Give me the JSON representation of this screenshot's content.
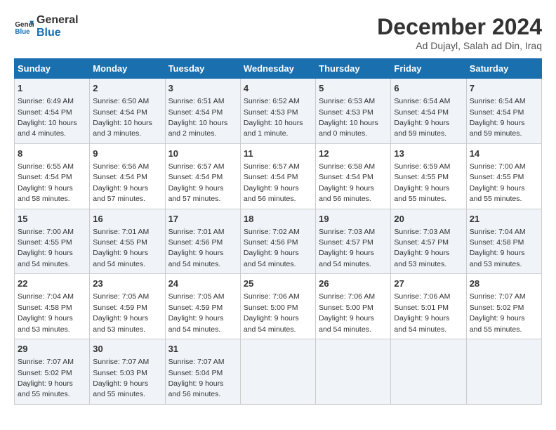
{
  "logo": {
    "line1": "General",
    "line2": "Blue"
  },
  "title": "December 2024",
  "subtitle": "Ad Dujayl, Salah ad Din, Iraq",
  "days_header": [
    "Sunday",
    "Monday",
    "Tuesday",
    "Wednesday",
    "Thursday",
    "Friday",
    "Saturday"
  ],
  "weeks": [
    [
      {
        "day": "1",
        "sunrise": "6:49 AM",
        "sunset": "4:54 PM",
        "daylight": "10 hours and 4 minutes."
      },
      {
        "day": "2",
        "sunrise": "6:50 AM",
        "sunset": "4:54 PM",
        "daylight": "10 hours and 3 minutes."
      },
      {
        "day": "3",
        "sunrise": "6:51 AM",
        "sunset": "4:54 PM",
        "daylight": "10 hours and 2 minutes."
      },
      {
        "day": "4",
        "sunrise": "6:52 AM",
        "sunset": "4:53 PM",
        "daylight": "10 hours and 1 minute."
      },
      {
        "day": "5",
        "sunrise": "6:53 AM",
        "sunset": "4:53 PM",
        "daylight": "10 hours and 0 minutes."
      },
      {
        "day": "6",
        "sunrise": "6:54 AM",
        "sunset": "4:54 PM",
        "daylight": "9 hours and 59 minutes."
      },
      {
        "day": "7",
        "sunrise": "6:54 AM",
        "sunset": "4:54 PM",
        "daylight": "9 hours and 59 minutes."
      }
    ],
    [
      {
        "day": "8",
        "sunrise": "6:55 AM",
        "sunset": "4:54 PM",
        "daylight": "9 hours and 58 minutes."
      },
      {
        "day": "9",
        "sunrise": "6:56 AM",
        "sunset": "4:54 PM",
        "daylight": "9 hours and 57 minutes."
      },
      {
        "day": "10",
        "sunrise": "6:57 AM",
        "sunset": "4:54 PM",
        "daylight": "9 hours and 57 minutes."
      },
      {
        "day": "11",
        "sunrise": "6:57 AM",
        "sunset": "4:54 PM",
        "daylight": "9 hours and 56 minutes."
      },
      {
        "day": "12",
        "sunrise": "6:58 AM",
        "sunset": "4:54 PM",
        "daylight": "9 hours and 56 minutes."
      },
      {
        "day": "13",
        "sunrise": "6:59 AM",
        "sunset": "4:55 PM",
        "daylight": "9 hours and 55 minutes."
      },
      {
        "day": "14",
        "sunrise": "7:00 AM",
        "sunset": "4:55 PM",
        "daylight": "9 hours and 55 minutes."
      }
    ],
    [
      {
        "day": "15",
        "sunrise": "7:00 AM",
        "sunset": "4:55 PM",
        "daylight": "9 hours and 54 minutes."
      },
      {
        "day": "16",
        "sunrise": "7:01 AM",
        "sunset": "4:55 PM",
        "daylight": "9 hours and 54 minutes."
      },
      {
        "day": "17",
        "sunrise": "7:01 AM",
        "sunset": "4:56 PM",
        "daylight": "9 hours and 54 minutes."
      },
      {
        "day": "18",
        "sunrise": "7:02 AM",
        "sunset": "4:56 PM",
        "daylight": "9 hours and 54 minutes."
      },
      {
        "day": "19",
        "sunrise": "7:03 AM",
        "sunset": "4:57 PM",
        "daylight": "9 hours and 54 minutes."
      },
      {
        "day": "20",
        "sunrise": "7:03 AM",
        "sunset": "4:57 PM",
        "daylight": "9 hours and 53 minutes."
      },
      {
        "day": "21",
        "sunrise": "7:04 AM",
        "sunset": "4:58 PM",
        "daylight": "9 hours and 53 minutes."
      }
    ],
    [
      {
        "day": "22",
        "sunrise": "7:04 AM",
        "sunset": "4:58 PM",
        "daylight": "9 hours and 53 minutes."
      },
      {
        "day": "23",
        "sunrise": "7:05 AM",
        "sunset": "4:59 PM",
        "daylight": "9 hours and 53 minutes."
      },
      {
        "day": "24",
        "sunrise": "7:05 AM",
        "sunset": "4:59 PM",
        "daylight": "9 hours and 54 minutes."
      },
      {
        "day": "25",
        "sunrise": "7:06 AM",
        "sunset": "5:00 PM",
        "daylight": "9 hours and 54 minutes."
      },
      {
        "day": "26",
        "sunrise": "7:06 AM",
        "sunset": "5:00 PM",
        "daylight": "9 hours and 54 minutes."
      },
      {
        "day": "27",
        "sunrise": "7:06 AM",
        "sunset": "5:01 PM",
        "daylight": "9 hours and 54 minutes."
      },
      {
        "day": "28",
        "sunrise": "7:07 AM",
        "sunset": "5:02 PM",
        "daylight": "9 hours and 55 minutes."
      }
    ],
    [
      {
        "day": "29",
        "sunrise": "7:07 AM",
        "sunset": "5:02 PM",
        "daylight": "9 hours and 55 minutes."
      },
      {
        "day": "30",
        "sunrise": "7:07 AM",
        "sunset": "5:03 PM",
        "daylight": "9 hours and 55 minutes."
      },
      {
        "day": "31",
        "sunrise": "7:07 AM",
        "sunset": "5:04 PM",
        "daylight": "9 hours and 56 minutes."
      },
      null,
      null,
      null,
      null
    ]
  ]
}
